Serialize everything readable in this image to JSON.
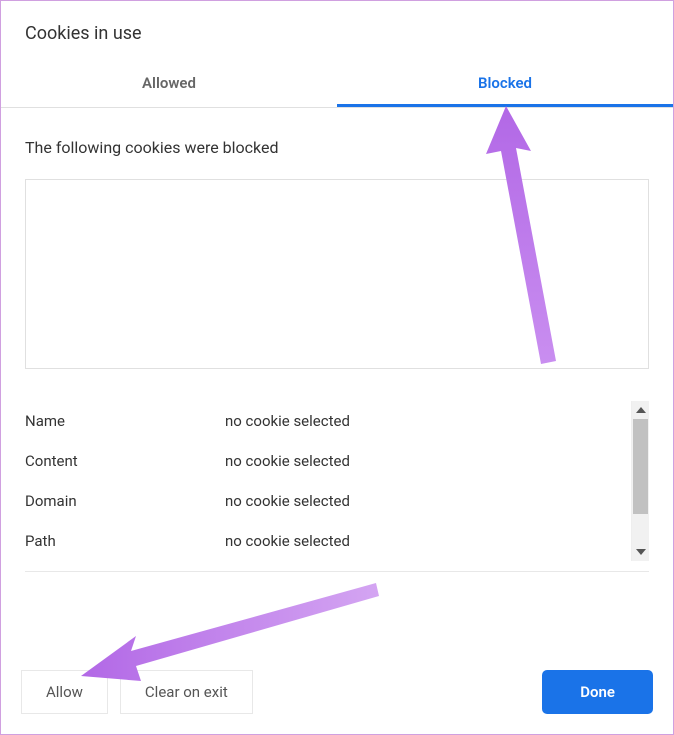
{
  "title": "Cookies in use",
  "tabs": {
    "allowed": "Allowed",
    "blocked": "Blocked"
  },
  "subtitle": "The following cookies were blocked",
  "details": {
    "name_label": "Name",
    "name_value": "no cookie selected",
    "content_label": "Content",
    "content_value": "no cookie selected",
    "domain_label": "Domain",
    "domain_value": "no cookie selected",
    "path_label": "Path",
    "path_value": "no cookie selected"
  },
  "buttons": {
    "allow": "Allow",
    "clear_on_exit": "Clear on exit",
    "done": "Done"
  }
}
